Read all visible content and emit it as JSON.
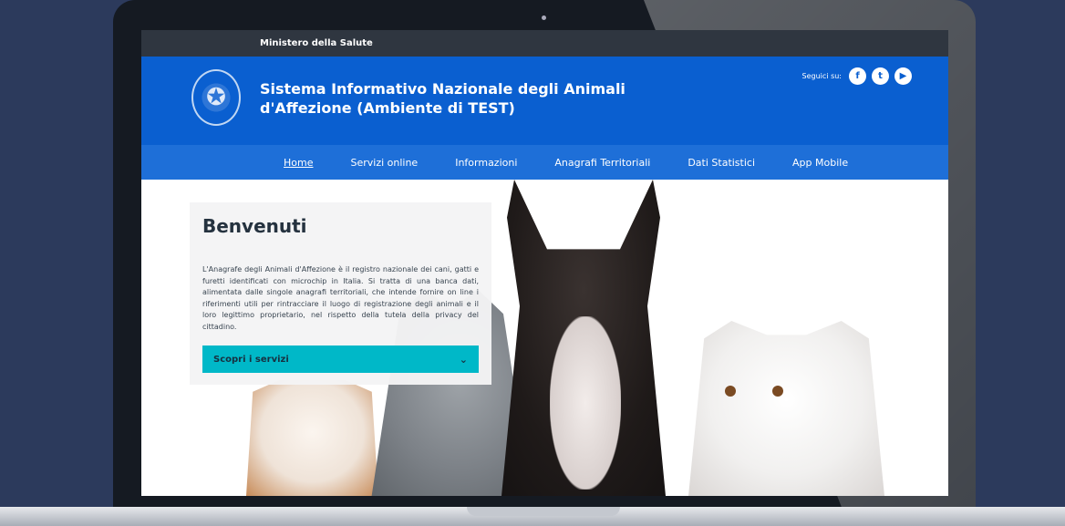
{
  "topbar": {
    "title": "Ministero della Salute"
  },
  "header": {
    "site_title": "Sistema Informativo Nazionale degli Animali d'Affezione (Ambiente di TEST)",
    "social_label": "Seguici su:",
    "social": [
      {
        "icon": "facebook-icon",
        "glyph": "f"
      },
      {
        "icon": "twitter-icon",
        "glyph": "t"
      },
      {
        "icon": "youtube-icon",
        "glyph": "▶"
      }
    ]
  },
  "nav": {
    "items": [
      {
        "label": "Home",
        "active": true
      },
      {
        "label": "Servizi online"
      },
      {
        "label": "Informazioni"
      },
      {
        "label": "Anagrafi Territoriali"
      },
      {
        "label": "Dati Statistici"
      },
      {
        "label": "App Mobile"
      }
    ]
  },
  "welcome": {
    "title": "Benvenuti",
    "body": "L'Anagrafe degli Animali d'Affezione è il registro nazionale dei cani, gatti e furetti identificati con microchip in Italia. Si tratta di una banca dati, alimentata dalle singole anagrafi territoriali, che intende fornire on line i riferimenti utili per rintracciare il luogo di registrazione degli animali e il loro legittimo proprietario, nel rispetto della tutela della privacy del cittadino.",
    "cta_label": "Scopri i servizi"
  },
  "colors": {
    "header_blue": "#0a5fd0",
    "nav_blue": "#1e6fd8",
    "cta_teal": "#00b8c8",
    "topbar": "#2f3640"
  }
}
